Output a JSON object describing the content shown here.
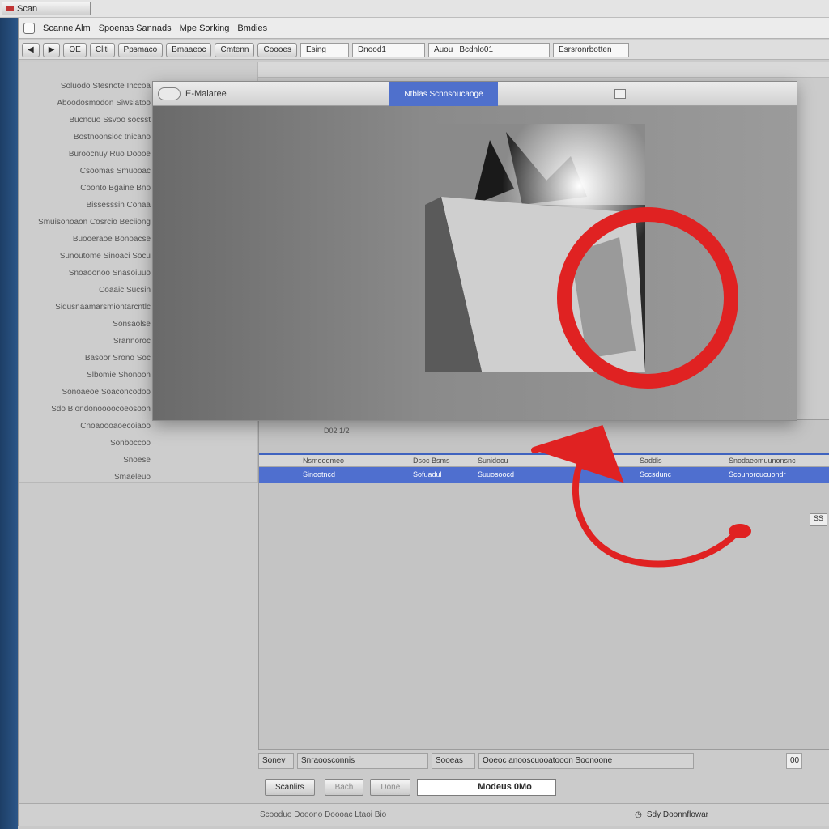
{
  "top_strip": {
    "tab_label": "Scan"
  },
  "menubar": {
    "items": [
      "Scanne Alm",
      "Spoenas Sannads",
      "Mpe Sorking",
      "Bmdies"
    ]
  },
  "toolbar": {
    "buttons": [
      "OE",
      "Cliti",
      "Ppsmaco",
      "Bmaaeoc",
      "Cmtenn",
      "Coooes"
    ],
    "search_label": "Esing",
    "field_1": "Dnood1",
    "field_2_label": "Auou",
    "field_2_value": "Bcdnlo01",
    "field_3": "Esrsronrbotten"
  },
  "left_panel": {
    "items": [
      "Soluodo Stesnote Inccoa",
      "Aboodosmodon Siwsiatoo",
      "Bucncuo Ssvoo socsst",
      "Bostnoonsioc tnicano",
      "Buroocnuy Ruo Doooe",
      "Csoomas Smuooac",
      "Coonto Bgaine Bno",
      "Bissesssin Conaa",
      "Smuisonoaon Cosrcio Beciiong",
      "Buooeraoe Bonoacse",
      "Sunoutome Sinoaci Socu",
      "Snoaoonoo Snasoiuuo",
      "Coaaic Sucsin",
      "Sidusnaamarsmiontarcntlc",
      "Sonsaolse",
      "Srannoroc",
      "Basoor Srono Soc",
      "Slbomie Shonoon",
      "Sonoaeoe Soaconcodoo",
      "Sdo Blondonoooocoeosoon",
      "Cnoaoooaoecoiaoo",
      "Sonboccoo",
      "Snoese",
      "Smaeleuo"
    ]
  },
  "dialog": {
    "title": "E-Maiaree",
    "tab": "Ntblas Scnnsoucaoge"
  },
  "list": {
    "headers": [
      "Nsmooomeo",
      "Dsoc Bsms",
      "Sunidocu",
      "Saddis",
      "Snodaeomuunonsnc"
    ],
    "selected_row": [
      "Sinootncd",
      "Sofuadul",
      "Suuosoocd",
      "Sccsdunc",
      "Scounorcucuondr"
    ],
    "header_strip_label": "D02 1/2",
    "side_control_label": "SS"
  },
  "status_fields": {
    "f1": "Sonev",
    "f2": "Snraoosconnis",
    "f3": "Sooeas",
    "f4": "Ooeoc anooscuooatooon Soonoone",
    "f5": "00"
  },
  "actions": {
    "scan": "Scanlirs",
    "back": "Bach",
    "done": "Done",
    "filename": "Modeus 0Mo"
  },
  "bottom_bar": {
    "left_text": "Scooduo Dooono Doooac Ltaoi Bio",
    "right_text": "Sdy Doonnflowar",
    "right_icon": "clock-icon"
  },
  "colors": {
    "selection_blue": "#4f6fcf",
    "annotation_red": "#e02222",
    "desktop_blue": "#1d3e66"
  }
}
